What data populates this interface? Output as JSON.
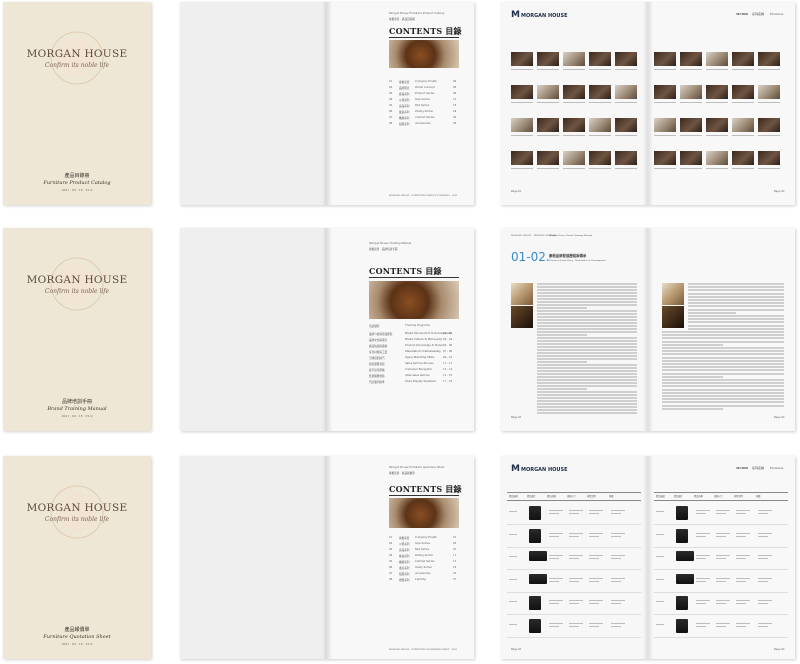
{
  "brand": {
    "name": "MORGAN HOUSE",
    "tagline": "Confirm its noble life"
  },
  "rows": [
    {
      "cover": {
        "title_cn": "產品目錄冊",
        "title_en": "Furniture Product Catalog",
        "small": "2021 · 03 · 15 · V1.0"
      },
      "toc": {
        "header_en": "Morgan House Furniture Product Catalog",
        "header_cn": "摩根家居 · 產品目錄冊",
        "title": "CONTENTS 目錄",
        "entries": [
          {
            "num": "01",
            "cn": "摩根家居",
            "en": "Company Profile",
            "page": "04"
          },
          {
            "num": "02",
            "cn": "品牌理念",
            "en": "Brand Concept",
            "page": "06"
          },
          {
            "num": "03",
            "cn": "產品系列",
            "en": "Product Series",
            "page": "08"
          },
          {
            "num": "04",
            "cn": "沙發系列",
            "en": "Sofa Series",
            "page": "12"
          },
          {
            "num": "05",
            "cn": "床品系列",
            "en": "Bed Series",
            "page": "18"
          },
          {
            "num": "06",
            "cn": "餐桌系列",
            "en": "Dining Series",
            "page": "24"
          },
          {
            "num": "07",
            "cn": "櫃類系列",
            "en": "Cabinet Series",
            "page": "30"
          },
          {
            "num": "08",
            "cn": "配飾系列",
            "en": "Accessories",
            "page": "36"
          }
        ],
        "footer": "MORGAN HOUSE · FURNITURE PRODUCT CATALOG · 2021"
      },
      "spread3": {
        "logo_mark": "M",
        "logo_text": "MORGAN HOUSE",
        "right_code": "MC800",
        "right_series": "系列名稱",
        "right_name": "Florence",
        "page_left": "Page 01",
        "page_right": "Page 02"
      }
    },
    {
      "cover": {
        "title_cn": "品牌培訓手冊",
        "title_en": "Brand Training Manual",
        "small": "2021 · 03 · 15 · V1.0"
      },
      "toc": {
        "header_en": "Morgan House Training Manual",
        "header_cn": "摩根家居 · 品牌培訓手冊",
        "title": "CONTENTS 目錄",
        "col_cn": "培訓課程",
        "col_en": "Training Programs",
        "entries": [
          {
            "cn": "品牌介紹與發展歷程",
            "en": "Brand Introduction & Development",
            "page": "01 - 02"
          },
          {
            "cn": "品牌文化與理念",
            "en": "Brand Culture & Philosophy",
            "page": "03 - 04"
          },
          {
            "cn": "產品知識與風格",
            "en": "Product Knowledge & Styles",
            "page": "05 - 06"
          },
          {
            "cn": "家具材質與工藝",
            "en": "Materials & Craftsmanship",
            "page": "07 - 08"
          },
          {
            "cn": "空間搭配技巧",
            "en": "Space Matching Skills",
            "page": "09 - 10"
          },
          {
            "cn": "銷售服務流程",
            "en": "Sales Service Process",
            "page": "11 - 12"
          },
          {
            "cn": "客戶接待禮儀",
            "en": "Customer Reception",
            "page": "13 - 14"
          },
          {
            "cn": "售後服務規範",
            "en": "After-sales Service",
            "page": "15 - 16"
          },
          {
            "cn": "門店陳列標準",
            "en": "Store Display Standard",
            "page": "17 - 18"
          }
        ]
      },
      "spread3": {
        "section_no": "01-02.",
        "section_cn": "摩根品牌發展歷程與傳承",
        "section_en": "Florence Brand Story · Inheritance & Development",
        "header_left": "MORGAN HOUSE · TRAINING MANUAL",
        "header_mid": "Morgan House Brand Training Manual",
        "page_left": "Page 01",
        "page_right": "Page 02"
      }
    },
    {
      "cover": {
        "title_cn": "產品報價單",
        "title_en": "Furniture Quotation Sheet",
        "small": "2021 · 03 · 15 · V1.0"
      },
      "toc": {
        "header_en": "Morgan House Furniture Quotation Sheet",
        "header_cn": "摩根家居 · 產品報價單",
        "title": "CONTENTS 目錄",
        "entries": [
          {
            "num": "01",
            "cn": "摩根家居",
            "en": "Company Profile",
            "page": "01"
          },
          {
            "num": "02",
            "cn": "沙發系列",
            "en": "Sofa Series",
            "page": "03"
          },
          {
            "num": "03",
            "cn": "床品系列",
            "en": "Bed Series",
            "page": "07"
          },
          {
            "num": "04",
            "cn": "餐桌系列",
            "en": "Dining Series",
            "page": "11"
          },
          {
            "num": "05",
            "cn": "櫃類系列",
            "en": "Cabinet Series",
            "page": "15"
          },
          {
            "num": "06",
            "cn": "書房系列",
            "en": "Study Series",
            "page": "19"
          },
          {
            "num": "07",
            "cn": "配飾系列",
            "en": "Accessories",
            "page": "23"
          },
          {
            "num": "08",
            "cn": "燈飾系列",
            "en": "Lighting",
            "page": "27"
          }
        ],
        "footer": "MORGAN HOUSE · FURNITURE QUOTATION SHEET · 2021"
      },
      "spread3": {
        "logo_mark": "M",
        "logo_text": "MORGAN HOUSE",
        "right_code": "MC800",
        "right_series": "系列名稱",
        "right_name": "Florence",
        "table_headers": [
          "產品編號",
          "產品圖片",
          "產品名稱",
          "規格尺寸",
          "材質說明",
          "單價"
        ],
        "page_left": "Page 01",
        "page_right": "Page 02"
      }
    }
  ]
}
